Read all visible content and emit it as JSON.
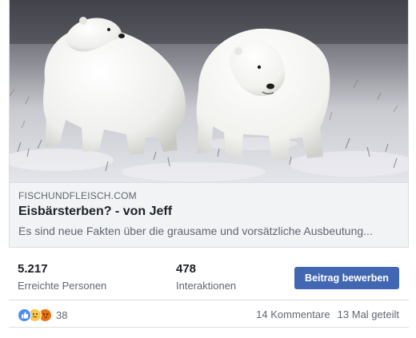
{
  "link_preview": {
    "image": "polar-bears-photo",
    "domain": "FISCHUNDFLEISCH.COM",
    "title": "Eisbärsterben? - von Jeff",
    "description": "Es sind neue Fakten über die grausame und vorsätzliche Ausbeutung..."
  },
  "insights": {
    "reach_value": "5.217",
    "reach_label": "Erreichte Personen",
    "engagement_value": "478",
    "engagement_label": "Interaktionen",
    "boost_label": "Beitrag bewerben"
  },
  "feedback": {
    "reaction_icons": [
      "like-icon",
      "sad-icon",
      "angry-icon"
    ],
    "reaction_count": "38",
    "comments": "14 Kommentare",
    "shares": "13 Mal geteilt"
  },
  "colors": {
    "accent": "#4267b2",
    "meta_bg": "#f2f3f5",
    "border": "#dadde1",
    "secondary_text": "#606770"
  }
}
